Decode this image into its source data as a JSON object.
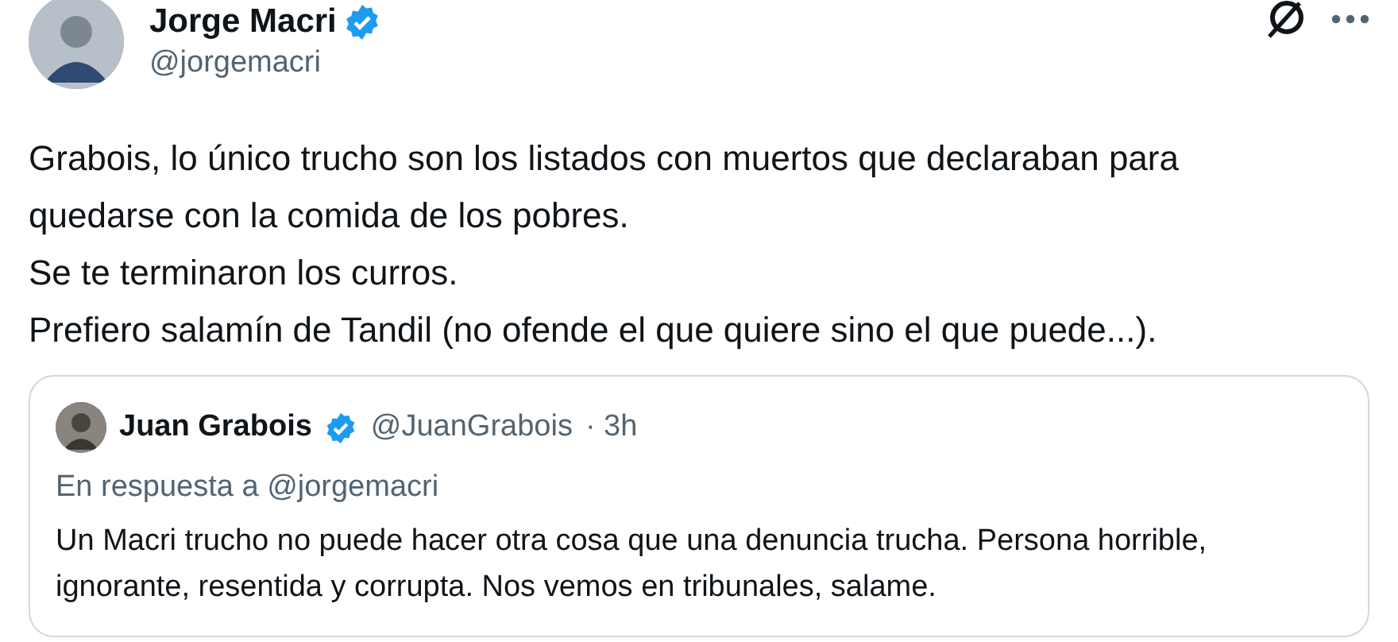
{
  "tweet": {
    "author": {
      "name": "Jorge Macri",
      "handle": "@jorgemacri",
      "verified": true
    },
    "text": [
      "Grabois, lo único trucho son los listados con muertos que declaraban para quedarse con la comida de los pobres.",
      "Se te terminaron los curros.",
      "Prefiero salamín de Tandil (no ofende el que quiere sino el que puede...)."
    ],
    "quote": {
      "author": {
        "name": "Juan Grabois",
        "handle": "@JuanGrabois",
        "verified": true
      },
      "time": "· 3h",
      "reply_to": "En respuesta a @jorgemacri",
      "text": "Un Macri trucho no puede hacer otra cosa que una denuncia trucha. Persona horrible, ignorante, resentida y corrupta. Nos vemos en tribunales, salame."
    }
  }
}
